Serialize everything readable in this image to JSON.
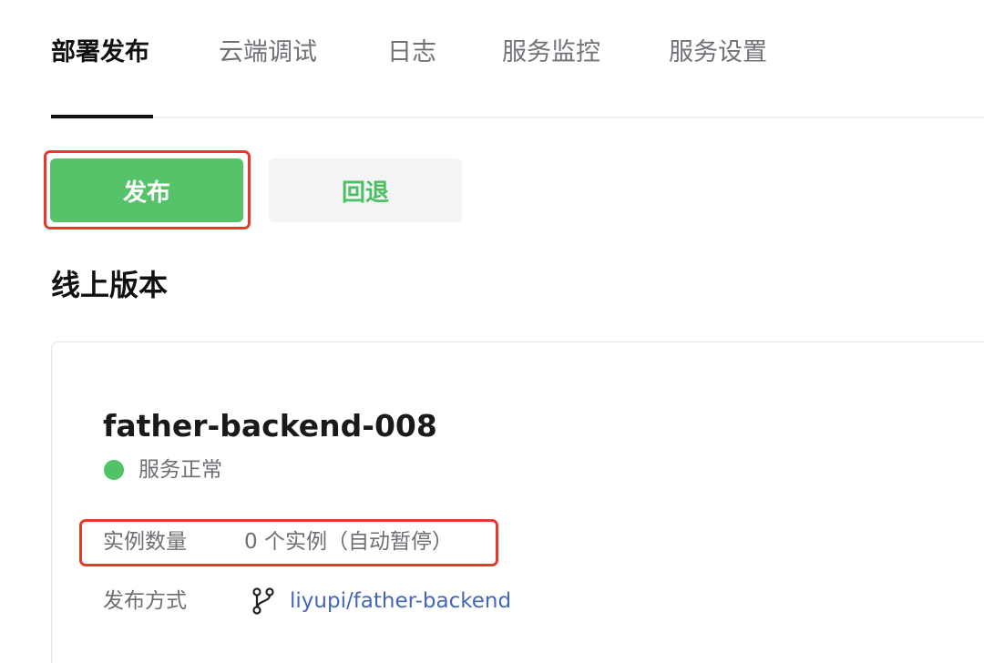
{
  "tabs": [
    {
      "label": "部署发布",
      "active": true
    },
    {
      "label": "云端调试",
      "active": false
    },
    {
      "label": "日志",
      "active": false
    },
    {
      "label": "服务监控",
      "active": false
    },
    {
      "label": "服务设置",
      "active": false
    }
  ],
  "actions": {
    "publish_label": "发布",
    "rollback_label": "回退"
  },
  "section": {
    "title": "线上版本"
  },
  "service": {
    "name": "father-backend-008",
    "status": "服务正常",
    "instances_label": "实例数量",
    "instances_value": "0 个实例（自动暂停）",
    "deploy_method_label": "发布方式",
    "repo": "liyupi/father-backend"
  },
  "icons": {
    "status": "status-dot-icon",
    "deploy": "git-branch-icon"
  },
  "colors": {
    "primary": "#56c26a",
    "status_ok": "#4fc366",
    "link": "#4466b8",
    "highlight": "#e53a2b",
    "active_tab": "#111111"
  }
}
